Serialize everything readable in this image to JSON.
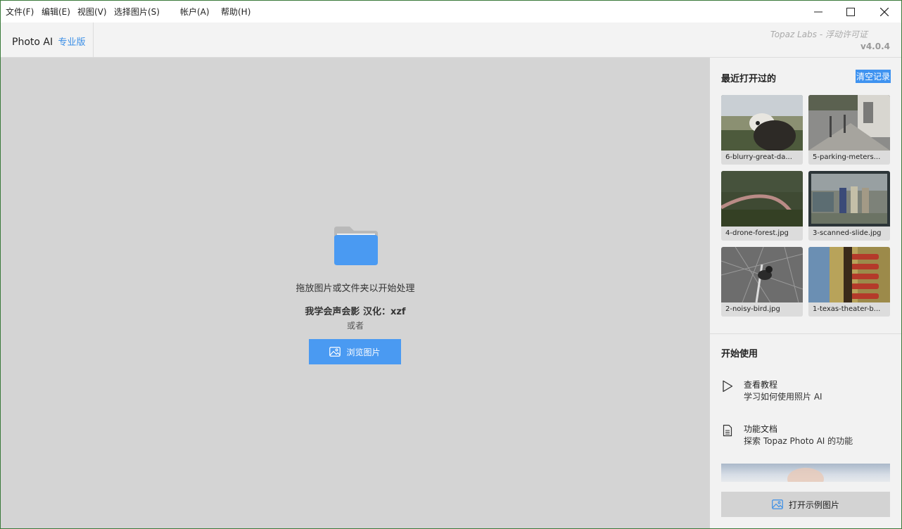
{
  "menu": [
    {
      "label": "文件(F)"
    },
    {
      "label": "编辑(E)"
    },
    {
      "label": "视图(V)"
    },
    {
      "label": "选择图片(S)"
    },
    {
      "label": "帐户(A)"
    },
    {
      "label": "帮助(H)"
    }
  ],
  "window_controls": {
    "minimize": "minimize-icon",
    "maximize": "maximize-icon",
    "close": "close-icon"
  },
  "header": {
    "app_name": "Photo AI",
    "edition": "专业版",
    "license": "Topaz Labs - 浮动许可证",
    "version": "v4.0.4"
  },
  "main": {
    "drop_text": "拖放图片或文件夹以开始处理",
    "credit_text": "我学会声会影 汉化：xzf",
    "or_text": "或者",
    "browse_label": "浏览图片",
    "accent": "#4a9af2"
  },
  "sidebar": {
    "recent_title": "最近打开过的",
    "clear_label": "清空记录",
    "recent": [
      {
        "name": "6-blurry-great-da..."
      },
      {
        "name": "5-parking-meters..."
      },
      {
        "name": "4-drone-forest.jpg"
      },
      {
        "name": "3-scanned-slide.jpg"
      },
      {
        "name": "2-noisy-bird.jpg"
      },
      {
        "name": "1-texas-theater-b..."
      }
    ],
    "start_title": "开始使用",
    "guides": [
      {
        "title": "查看教程",
        "subtitle": "学习如何使用照片 AI",
        "icon": "play-icon"
      },
      {
        "title": "功能文档",
        "subtitle": "探索 Topaz Photo AI 的功能",
        "icon": "document-icon"
      }
    ],
    "sample_label": "打开示例图片"
  }
}
